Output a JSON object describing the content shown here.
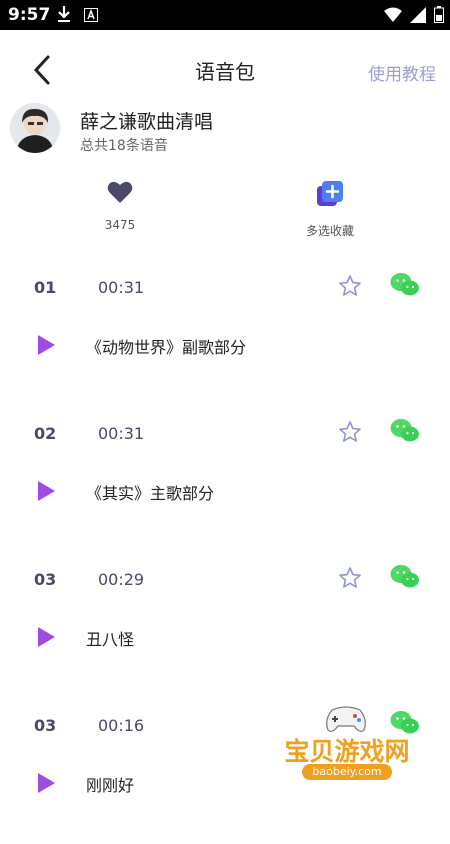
{
  "status_bar": {
    "time": "9:57"
  },
  "header": {
    "title": "语音包",
    "tutorial_label": "使用教程"
  },
  "pack": {
    "name": "薛之谦歌曲清唱",
    "count_text": "总共18条语音"
  },
  "actions": {
    "like_count": "3475",
    "multi_collect_label": "多选收藏"
  },
  "tracks": [
    {
      "num": "01",
      "duration": "00:31",
      "title": "《动物世界》副歌部分"
    },
    {
      "num": "02",
      "duration": "00:31",
      "title": "《其实》主歌部分"
    },
    {
      "num": "03",
      "duration": "00:29",
      "title": "丑八怪"
    },
    {
      "num": "03",
      "duration": "00:16",
      "title": "刚刚好"
    }
  ],
  "watermark": {
    "name": "宝贝游戏网",
    "url": "baobeiy.com"
  },
  "colors": {
    "accent_purple": "#a04ce0",
    "tutorial_text": "#9e9ed0",
    "wechat_green": "#4cd964",
    "heart": "#4a4a68",
    "multi_icon": "#5560e8"
  }
}
